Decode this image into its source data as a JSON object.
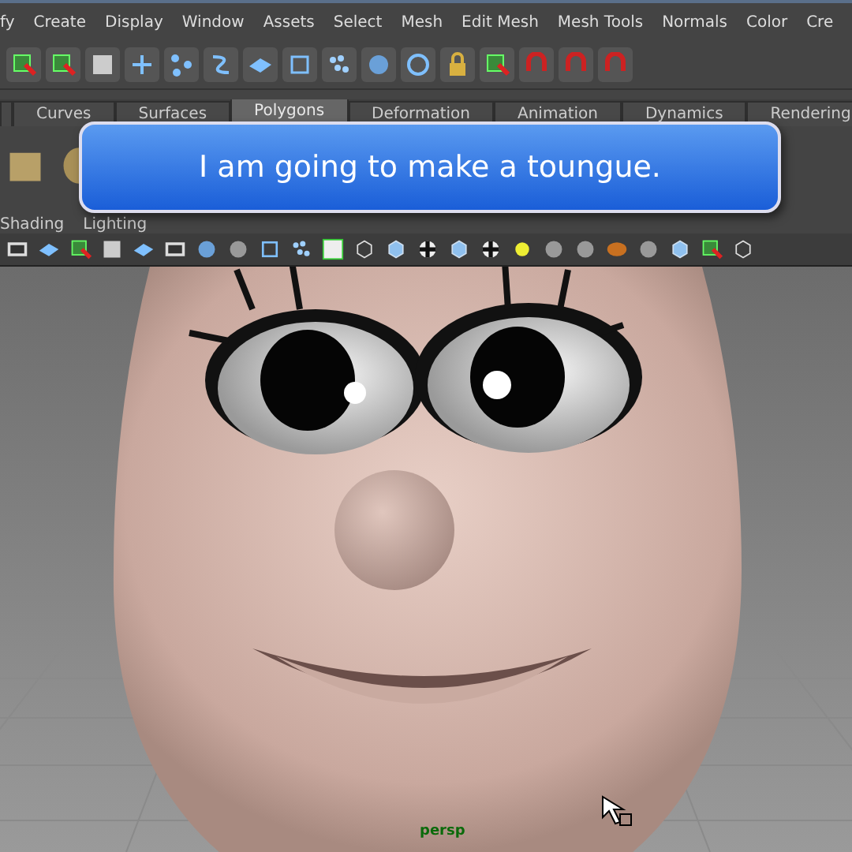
{
  "menu_bar": {
    "items": [
      "fy",
      "Create",
      "Display",
      "Window",
      "Assets",
      "Select",
      "Mesh",
      "Edit Mesh",
      "Mesh Tools",
      "Normals",
      "Color",
      "Cre"
    ]
  },
  "shelf_tabs": [
    {
      "label": "Curves",
      "selected": false
    },
    {
      "label": "Surfaces",
      "selected": false
    },
    {
      "label": "Polygons",
      "selected": true
    },
    {
      "label": "Deformation",
      "selected": false
    },
    {
      "label": "Animation",
      "selected": false
    },
    {
      "label": "Dynamics",
      "selected": false
    },
    {
      "label": "Rendering",
      "selected": false
    }
  ],
  "callout": {
    "text": "I am going to make a toungue."
  },
  "panel_menu": {
    "items": [
      "Shading",
      "Lighting"
    ]
  },
  "viewport": {
    "camera_label": "persp"
  }
}
